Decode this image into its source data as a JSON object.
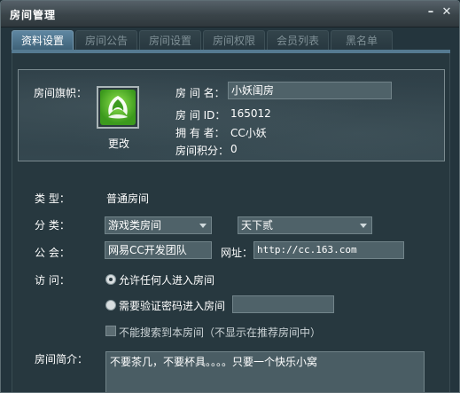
{
  "window": {
    "title": "房间管理",
    "minimize_glyph": "–",
    "close_glyph": "✕"
  },
  "tabs": [
    {
      "label": "资料设置",
      "active": true
    },
    {
      "label": "房间公告",
      "active": false
    },
    {
      "label": "房间设置",
      "active": false
    },
    {
      "label": "房间权限",
      "active": false
    },
    {
      "label": "会员列表",
      "active": false
    },
    {
      "label": "黑名单",
      "active": false
    }
  ],
  "profile": {
    "banner_label": "房间旗帜：",
    "change_label": "更改",
    "name_label": "房 间 名：",
    "name_value": "小妖闺房",
    "id_label": "房 间 ID：",
    "id_value": "165012",
    "owner_label": "拥 有 者：",
    "owner_value": "CC小妖",
    "points_label": "房间积分：",
    "points_value": "0"
  },
  "form": {
    "type_label": "类    型：",
    "type_value": "普通房间",
    "category_label": "分    类：",
    "category_value": "游戏类房间",
    "subcategory_value": "天下贰",
    "guild_label": "公    会：",
    "guild_value": "网易CC开发团队",
    "url_label": "网址：",
    "url_value": "http://cc.163.com",
    "access_label": "访    问：",
    "access_option_anyone": "允许任何人进入房间",
    "access_option_password": "需要验证密码进入房间",
    "access_selected": "anyone",
    "password_value": "",
    "unsearchable_label": "不能搜索到本房间（不显示在推荐房间中）",
    "unsearchable_checked": false,
    "intro_label": "房间简介：",
    "intro_value": "不要茶几，不要杯具。。。。只要一个快乐小窝"
  },
  "colors": {
    "window_bg": "#24353d",
    "tab_active": "#4f7790",
    "input_bg": "#4f6269",
    "text": "#ffffff"
  },
  "icons": {
    "banner": "green-leaf-logo-icon",
    "minimize": "minimize-icon",
    "close": "close-icon",
    "dropdown": "chevron-down-icon"
  }
}
